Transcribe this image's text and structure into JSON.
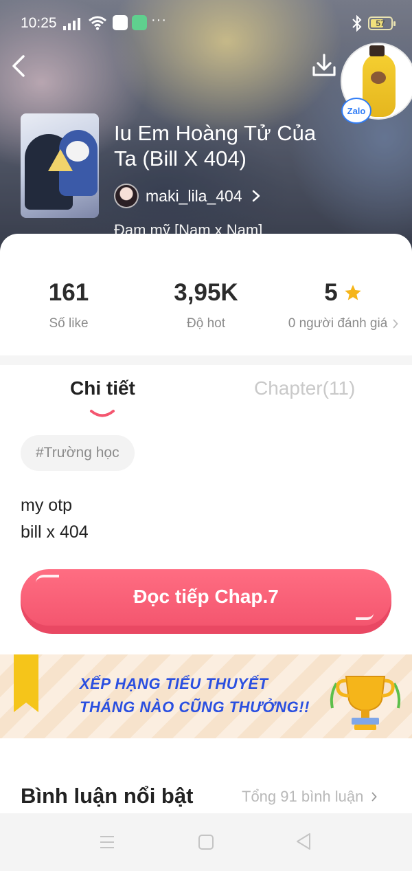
{
  "status_bar": {
    "time": "10:25",
    "battery": "57",
    "more": "···"
  },
  "header": {
    "title": "Iu Em Hoàng Tử Của Ta (Bill X 404)",
    "author": "maki_lila_404",
    "genre": "Đam mỹ [Nam x Nam]",
    "overlay_badge": "Zalo"
  },
  "stats": {
    "likes": {
      "value": "161",
      "label": "Số like"
    },
    "hot": {
      "value": "3,95K",
      "label": "Độ hot"
    },
    "rating": {
      "value": "5",
      "label": "0 người đánh giá"
    }
  },
  "tabs": [
    {
      "label": "Chi tiết",
      "active": true
    },
    {
      "label": "Chapter(11)",
      "active": false
    }
  ],
  "tags": [
    "#Trường học"
  ],
  "description": [
    "my otp",
    "bill x 404"
  ],
  "read_button": {
    "label": "Đọc tiếp Chap.7"
  },
  "banner": {
    "line1": "XẾP HẠNG TIỂU THUYẾT",
    "line2": "THÁNG NÀO CŨNG THƯỞNG!!"
  },
  "comments": {
    "title": "Bình luận nổi bật",
    "total": "Tổng 91 bình luận"
  },
  "colors": {
    "accent": "#f4566f",
    "star": "#f5b51a",
    "banner_text": "#2a4fe0"
  },
  "icons": [
    "back-arrow-icon",
    "download-icon",
    "chevron-right-icon",
    "star-icon",
    "menu-icon",
    "home-icon",
    "nav-back-icon"
  ]
}
